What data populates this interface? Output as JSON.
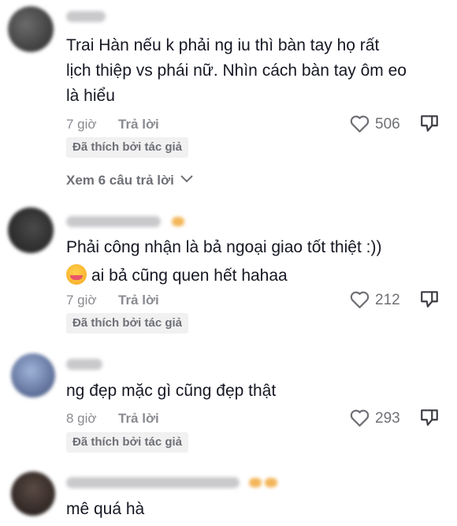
{
  "comments": [
    {
      "text_lines": [
        "Trai Hàn nếu k phải ng iu thì bàn tay họ rất",
        "lịch thiệp vs phái nữ. Nhìn cách bàn tay ôm eo",
        "là hiểu"
      ],
      "time": "7 giờ",
      "reply_label": "Trả lời",
      "likes": "506",
      "badge": "Đã thích bởi tác giả",
      "view_replies": "Xem 6 câu trả lời"
    },
    {
      "text_lines": [
        "Phải công nhận là bả ngoại giao tốt thiệt :))",
        "ai bả cũng quen hết hahaa"
      ],
      "time": "7 giờ",
      "reply_label": "Trả lời",
      "likes": "212",
      "badge": "Đã thích bởi tác giả"
    },
    {
      "text_lines": [
        "ng đẹp mặc gì cũng đẹp thật"
      ],
      "time": "8 giờ",
      "reply_label": "Trả lời",
      "likes": "293",
      "badge": "Đã thích bởi tác giả"
    },
    {
      "text_lines": [
        "mê quá hà"
      ]
    }
  ],
  "icons": {
    "like": "heart-outline-icon",
    "dislike": "thumbs-down-icon",
    "expand": "chevron-down-icon"
  },
  "colors": {
    "text": "#161823",
    "meta": "#8a8b91",
    "badge_bg": "#f1f1f2"
  }
}
